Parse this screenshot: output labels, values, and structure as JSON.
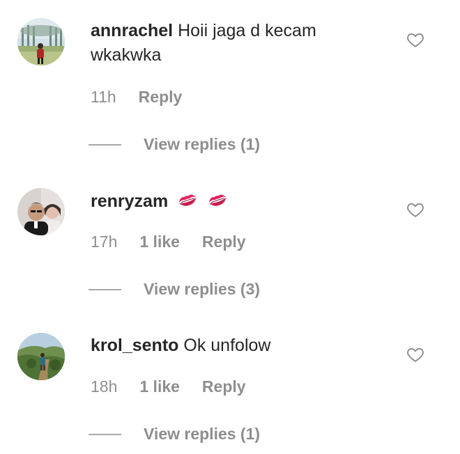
{
  "comments": [
    {
      "username": "annrachel",
      "text": "Hoii jaga d kecam wkakwka",
      "time": "11h",
      "likes": "",
      "reply_label": "Reply",
      "view_replies": "View replies (1)",
      "avatar_icon": "avatar-photo-outdoor",
      "like_icon": "heart-outline-icon"
    },
    {
      "username": "renryzam",
      "text": "",
      "emojis": [
        "kiss-mark-icon",
        "kiss-mark-icon"
      ],
      "time": "17h",
      "likes": "1 like",
      "reply_label": "Reply",
      "view_replies": "View replies (3)",
      "avatar_icon": "avatar-photo-selfie",
      "like_icon": "heart-outline-icon"
    },
    {
      "username": "krol_sento",
      "text": "Ok unfolow",
      "time": "18h",
      "likes": "1 like",
      "reply_label": "Reply",
      "view_replies": "View replies (1)",
      "avatar_icon": "avatar-photo-hiking",
      "like_icon": "heart-outline-icon"
    }
  ],
  "colors": {
    "text_primary": "#262626",
    "text_secondary": "#8e8e8e",
    "kiss": "#e0245e"
  }
}
